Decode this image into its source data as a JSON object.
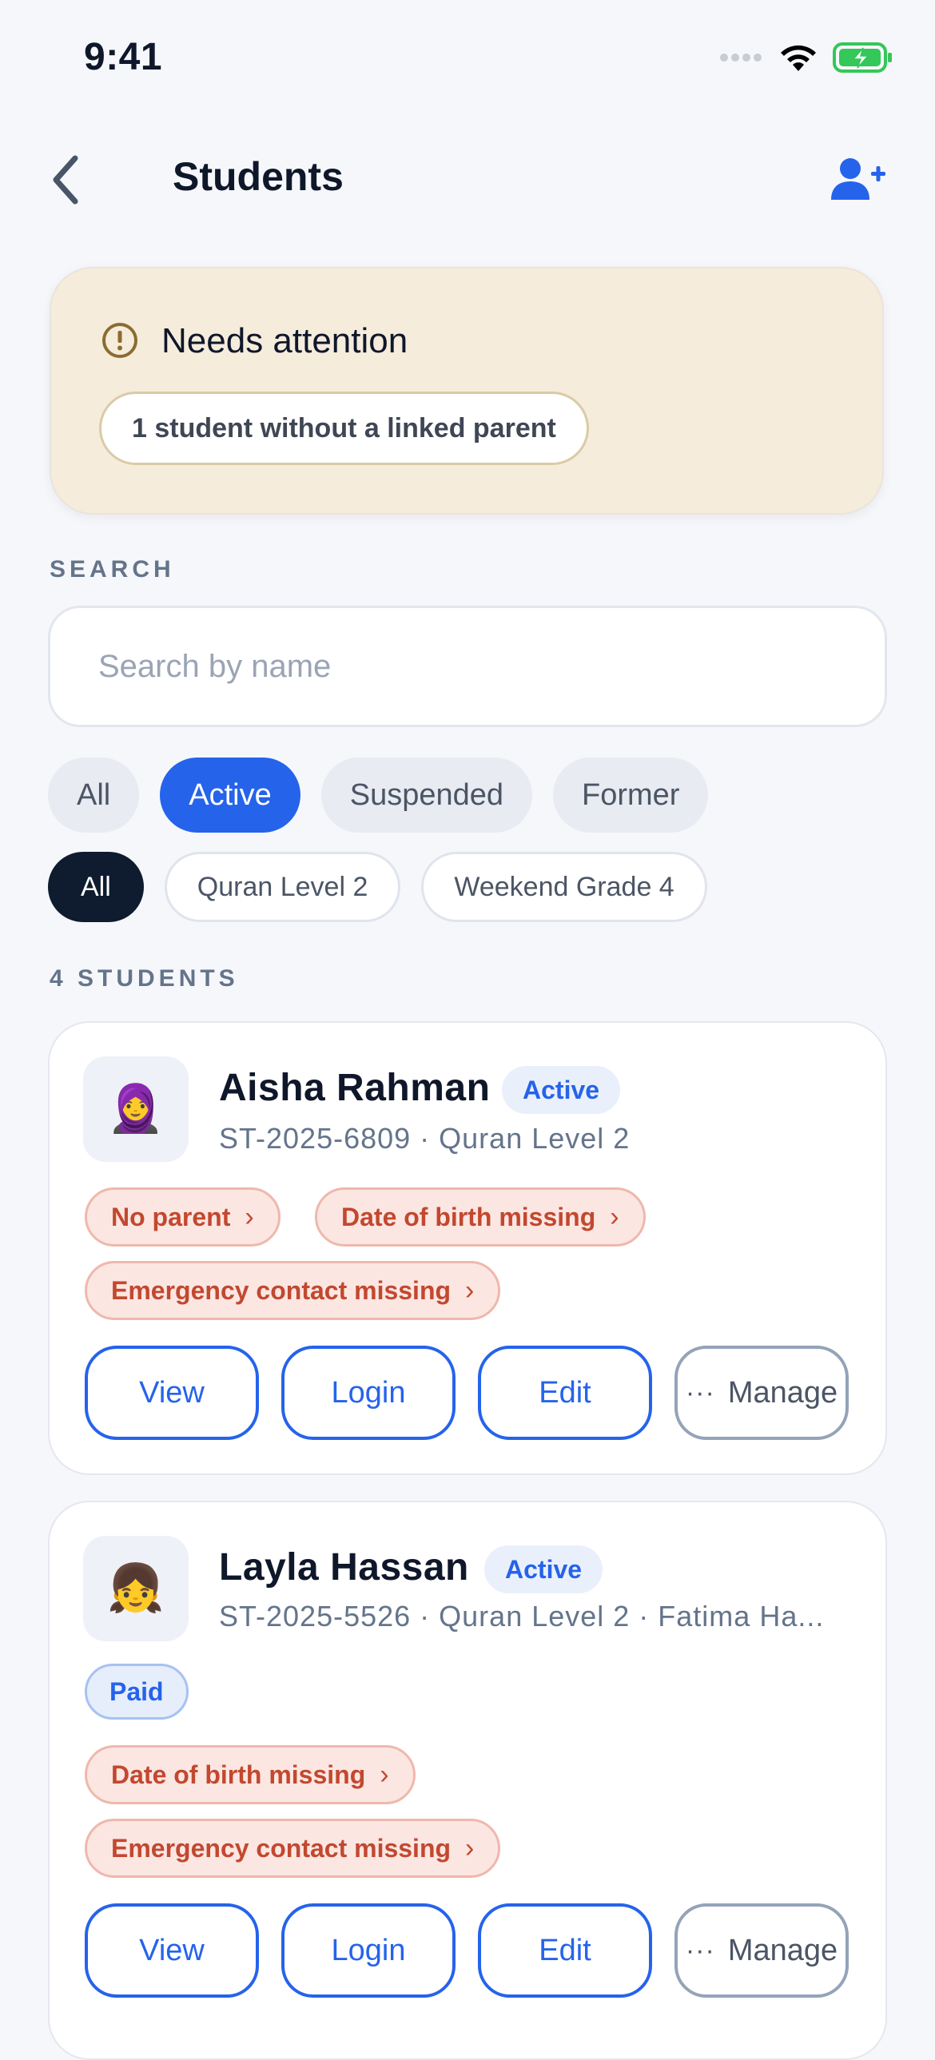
{
  "status_bar": {
    "time": "9:41"
  },
  "header": {
    "title": "Students"
  },
  "attention": {
    "title": "Needs attention",
    "chip": "1 student without a linked parent"
  },
  "search": {
    "label": "SEARCH",
    "placeholder": "Search by name"
  },
  "status_filters": [
    "All",
    "Active",
    "Suspended",
    "Former"
  ],
  "status_filter_selected": "Active",
  "class_filters": [
    "All",
    "Quran Level 2",
    "Weekend Grade 4"
  ],
  "class_filter_selected": "All",
  "count_label": "4 STUDENTS",
  "students": [
    {
      "avatar": "🧕",
      "name": "Aisha Rahman",
      "status": "Active",
      "subtitle": "ST-2025-6809 · Quran Level 2",
      "badges": [],
      "warnings": [
        "No parent",
        "Date of birth missing",
        "Emergency contact missing"
      ],
      "actions": [
        "View",
        "Login",
        "Edit",
        "Manage"
      ]
    },
    {
      "avatar": "👧",
      "name": "Layla Hassan",
      "status": "Active",
      "subtitle": "ST-2025-5526 · Quran Level 2 · Fatima Ha...",
      "badges": [
        "Paid"
      ],
      "warnings": [
        "Date of birth missing",
        "Emergency contact missing"
      ],
      "actions": [
        "View",
        "Login",
        "Edit",
        "Manage"
      ]
    }
  ],
  "colors": {
    "accent": "#2563eb",
    "attention_bg": "#f5ecdc",
    "warning_text": "#c2482f",
    "warning_bg": "#fbe6e2"
  }
}
